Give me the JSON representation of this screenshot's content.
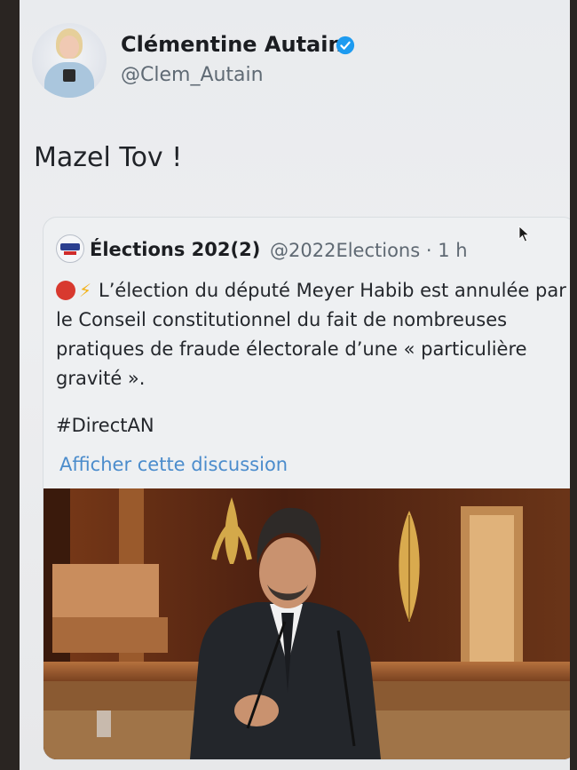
{
  "tweet": {
    "author_name": "Clémentine Autain",
    "author_handle": "@Clem_Autain",
    "text": "Mazel Tov !"
  },
  "quoted_tweet": {
    "author_name": "Élections 202(2)",
    "meta": "@2022Elections · 1 h",
    "body": "L’élection du député Meyer Habib est annulée par le Conseil constitutionnel du fait de nombreuses pratiques de fraude électorale d’une « particulière gravité ».",
    "hashtag": "#DirectAN",
    "show_thread_link": "Afficher cette discussion"
  },
  "icons": {
    "verified": "verified-badge-icon",
    "red_circle": "red-circle-emoji",
    "lightning": "lightning-emoji",
    "cursor": "mouse-pointer-icon"
  },
  "colors": {
    "verified_blue": "#1d9bf0",
    "link_blue": "#4b8ccc"
  }
}
